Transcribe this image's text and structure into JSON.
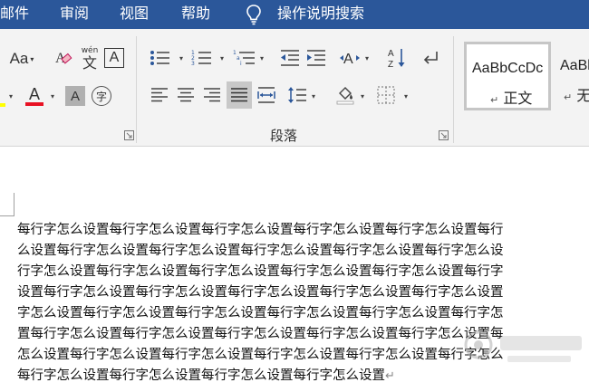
{
  "menu": {
    "items": [
      "邮件",
      "审阅",
      "视图",
      "帮助"
    ],
    "tell_me": "操作说明搜索"
  },
  "ribbon": {
    "font_size_button": "Aa",
    "phonetic_label": "wén",
    "phonetic_char": "文",
    "border_char": "A",
    "font_color_char": "A",
    "shading_char": "A",
    "enclose_char": "字",
    "paragraph_group_label": "段落"
  },
  "styles": {
    "items": [
      {
        "sample": "AaBbCcDc",
        "name": "正文"
      },
      {
        "sample": "AaBl",
        "name": "无"
      }
    ]
  },
  "document": {
    "lines": [
      "每行字怎么设置每行字怎么设置每行字怎么设置每行字怎么设置每行字怎么设置每行",
      "么设置每行字怎么设置每行字怎么设置每行字怎么设置每行字怎么设置每行字怎么设",
      "行字怎么设置每行字怎么设置每行字怎么设置每行字怎么设置每行字怎么设置每行字",
      "设置每行字怎么设置每行字怎么设置每行字怎么设置每行字怎么设置每行字怎么设置",
      "字怎么设置每行字怎么设置每行字怎么设置每行字怎么设置每行字怎么设置每行字怎",
      "置每行字怎么设置每行字怎么设置每行字怎么设置每行字怎么设置每行字怎么设置每",
      "怎么设置每行字怎么设置每行字怎么设置每行字怎么设置每行字怎么设置每行字怎么",
      "每行字怎么设置每行字怎么设置每行字怎么设置每行字怎么设置"
    ],
    "paragraph_mark": "↵"
  },
  "colors": {
    "title_bar": "#2b579a",
    "ribbon_bg": "#f3f3f3",
    "font_color_underline": "#e81123",
    "highlight_underline": "#ffff00",
    "active_button_bg": "#c8c8c8"
  }
}
